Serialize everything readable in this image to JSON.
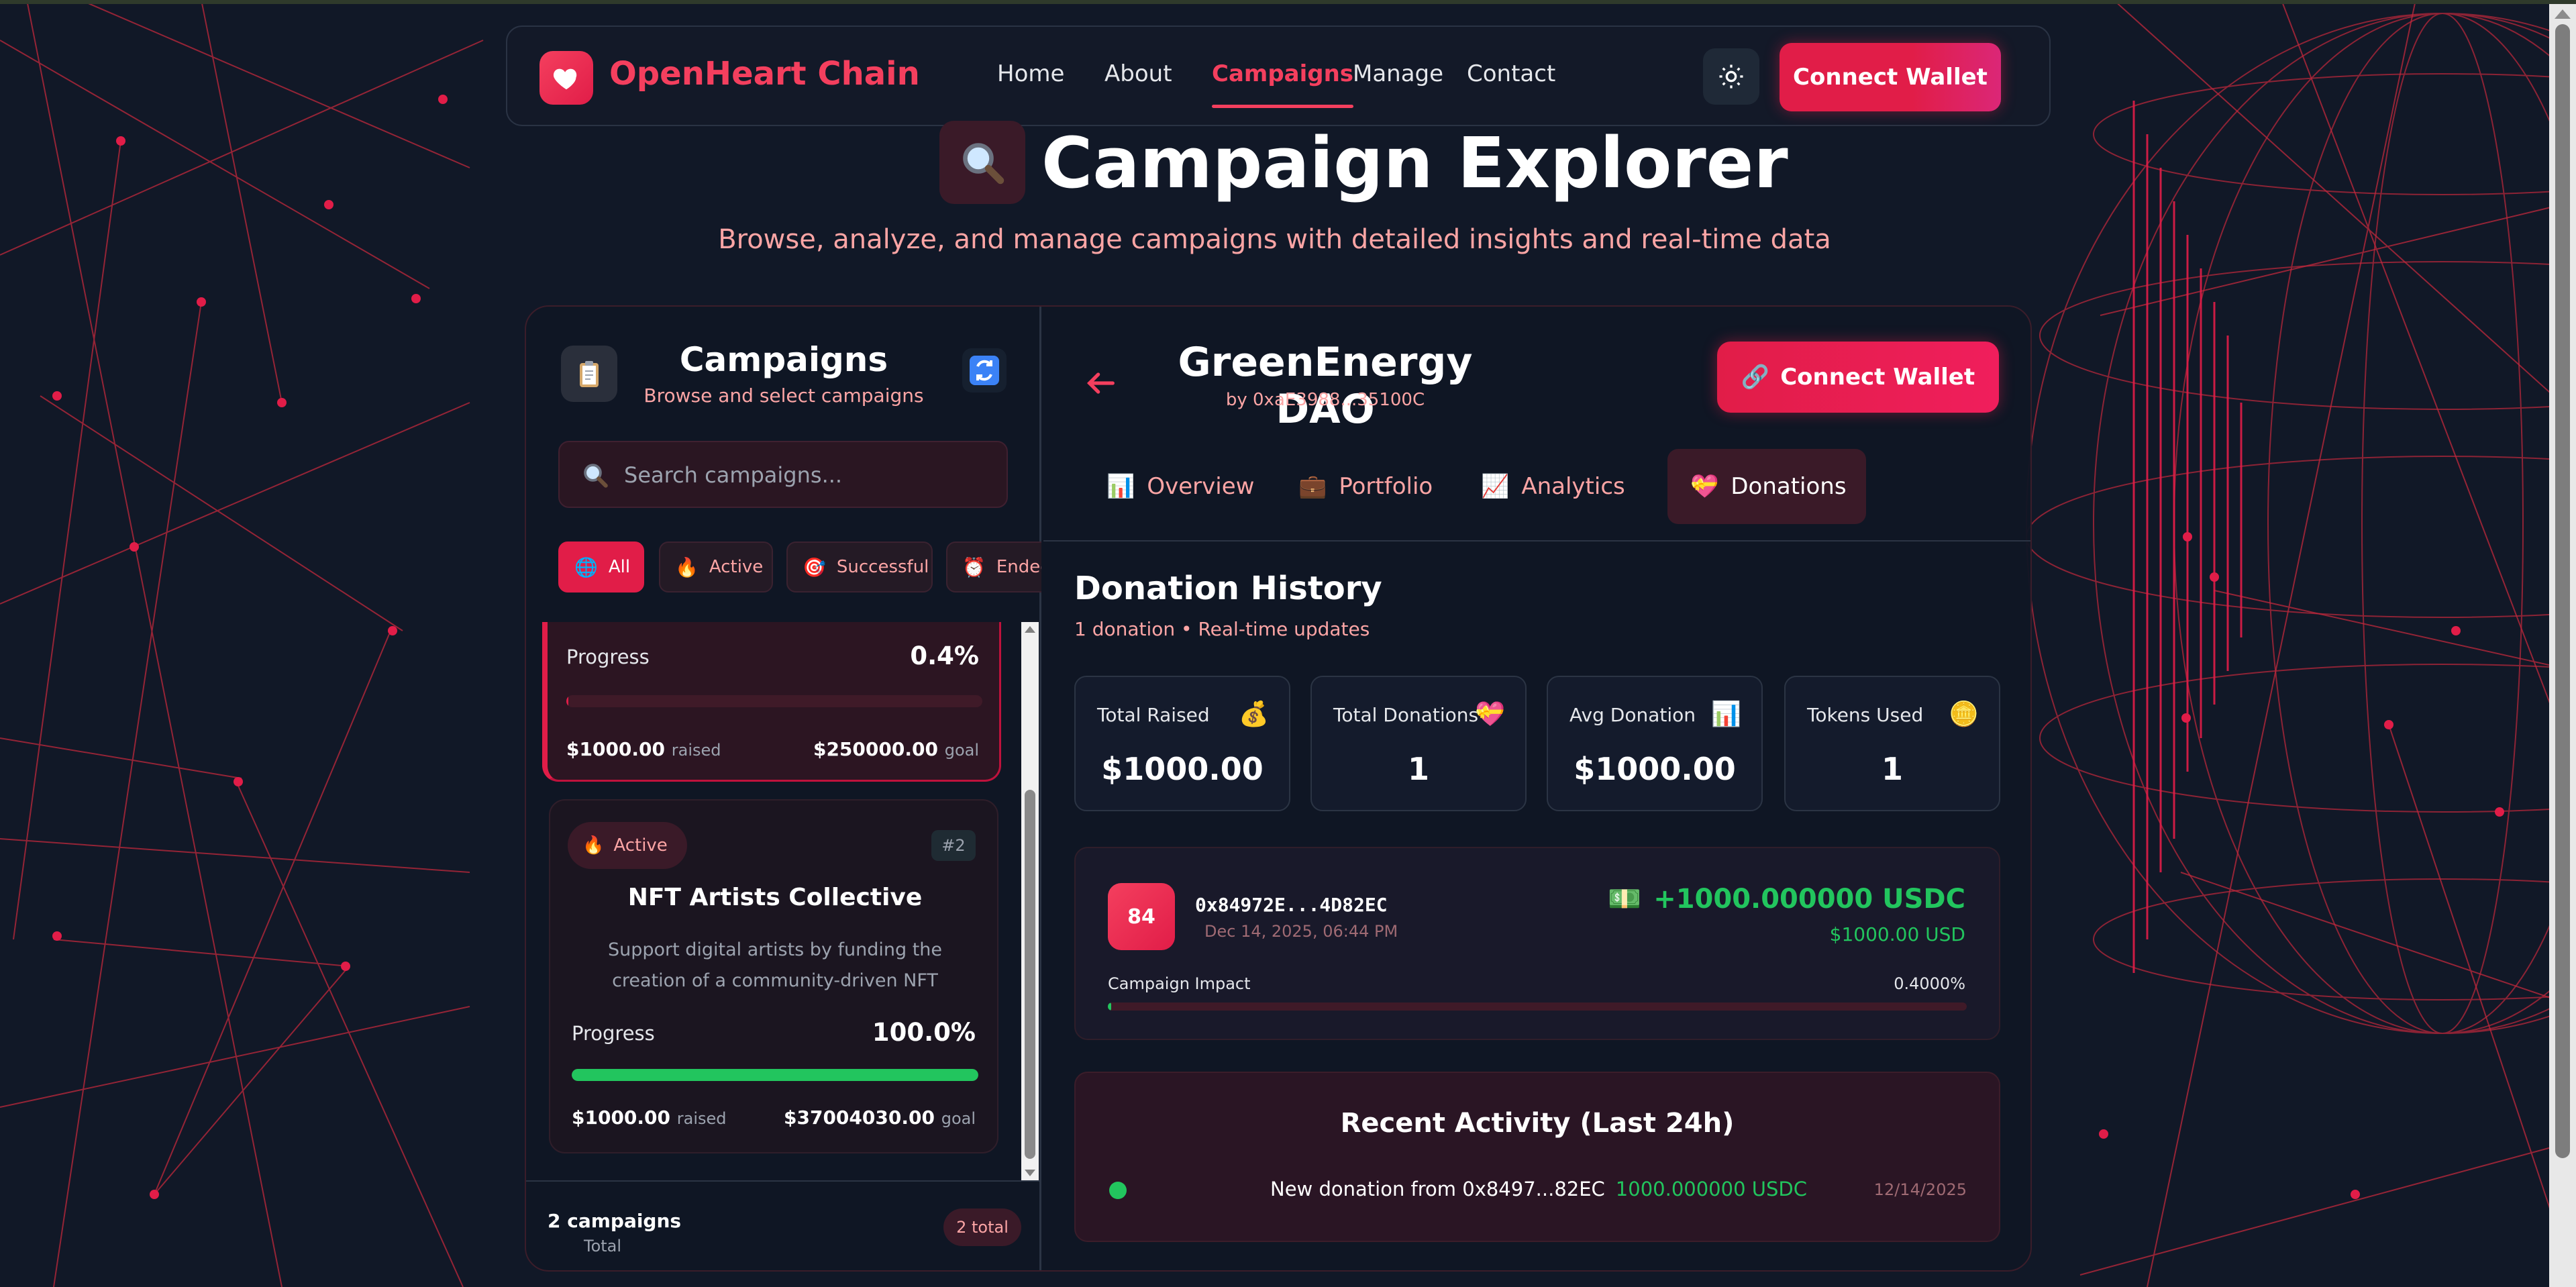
{
  "nav": {
    "brand": "OpenHeart Chain",
    "items": [
      "Home",
      "About",
      "Campaigns",
      "Manage",
      "Contact"
    ],
    "active": "Campaigns",
    "connect_label": "Connect Wallet"
  },
  "header": {
    "title": "Campaign Explorer",
    "subtitle": "Browse, analyze, and manage campaigns with detailed insights and real-time data"
  },
  "sidebar": {
    "title": "Campaigns",
    "subtitle": "Browse and select campaigns",
    "search_placeholder": "Search campaigns...",
    "filters": [
      {
        "icon": "🌐",
        "label": "All"
      },
      {
        "icon": "🔥",
        "label": "Active"
      },
      {
        "icon": "🎯",
        "label": "Successful"
      },
      {
        "icon": "⏰",
        "label": "Ended"
      }
    ],
    "cards": [
      {
        "progress_label": "Progress",
        "progress_text": "0.4%",
        "progress": 0.004,
        "raised": "$1000.00",
        "raised_suffix": "raised",
        "goal": "$250000.00",
        "goal_suffix": "goal"
      },
      {
        "status_icon": "🔥",
        "status": "Active",
        "number": "#2",
        "title": "NFT Artists Collective",
        "description": "Support digital artists by funding the creation of a community-driven NFT marketplace on th...",
        "progress_label": "Progress",
        "progress_text": "100.0%",
        "progress": 1.0,
        "raised": "$1000.00",
        "raised_suffix": "raised",
        "goal": "$37004030.00",
        "goal_suffix": "goal"
      }
    ],
    "footer_count": "2 campaigns",
    "footer_total_label": "Total",
    "footer_pill": "2 total"
  },
  "detail": {
    "name": "GreenEnergy DAO",
    "by": "by 0xaE3988...35100C",
    "connect_label": "Connect Wallet",
    "connect_icon": "🔗",
    "tabs": [
      {
        "icon": "📊",
        "label": "Overview"
      },
      {
        "icon": "💼",
        "label": "Portfolio"
      },
      {
        "icon": "📈",
        "label": "Analytics"
      },
      {
        "icon": "💝",
        "label": "Donations"
      }
    ],
    "active_tab": "Donations",
    "history_title": "Donation History",
    "history_sub": "1 donation • Real-time updates",
    "stats": [
      {
        "label": "Total Raised",
        "icon": "💰",
        "value": "$1000.00"
      },
      {
        "label": "Total Donations",
        "icon": "💝",
        "value": "1"
      },
      {
        "label": "Avg Donation",
        "icon": "📊",
        "value": "$1000.00"
      },
      {
        "label": "Tokens Used",
        "icon": "🪙",
        "value": "1"
      }
    ],
    "donation": {
      "avatar": "84",
      "address": "0x84972E...4D82EC",
      "date": "Dec 14, 2025, 06:44 PM",
      "amount_icon": "💵",
      "amount": "+1000.000000 USDC",
      "usd": "$1000.00 USD",
      "impact_label": "Campaign Impact",
      "impact_text": "0.4000%",
      "impact": 0.004
    },
    "recent": {
      "title": "Recent Activity (Last 24h)",
      "text": "New donation from 0x8497...82EC",
      "amount": "1000.000000 USDC",
      "date": "12/14/2025"
    }
  },
  "colors": {
    "accent": "#e11d48",
    "brand": "#f43f5e",
    "success": "#22c55e",
    "background": "#111827"
  }
}
